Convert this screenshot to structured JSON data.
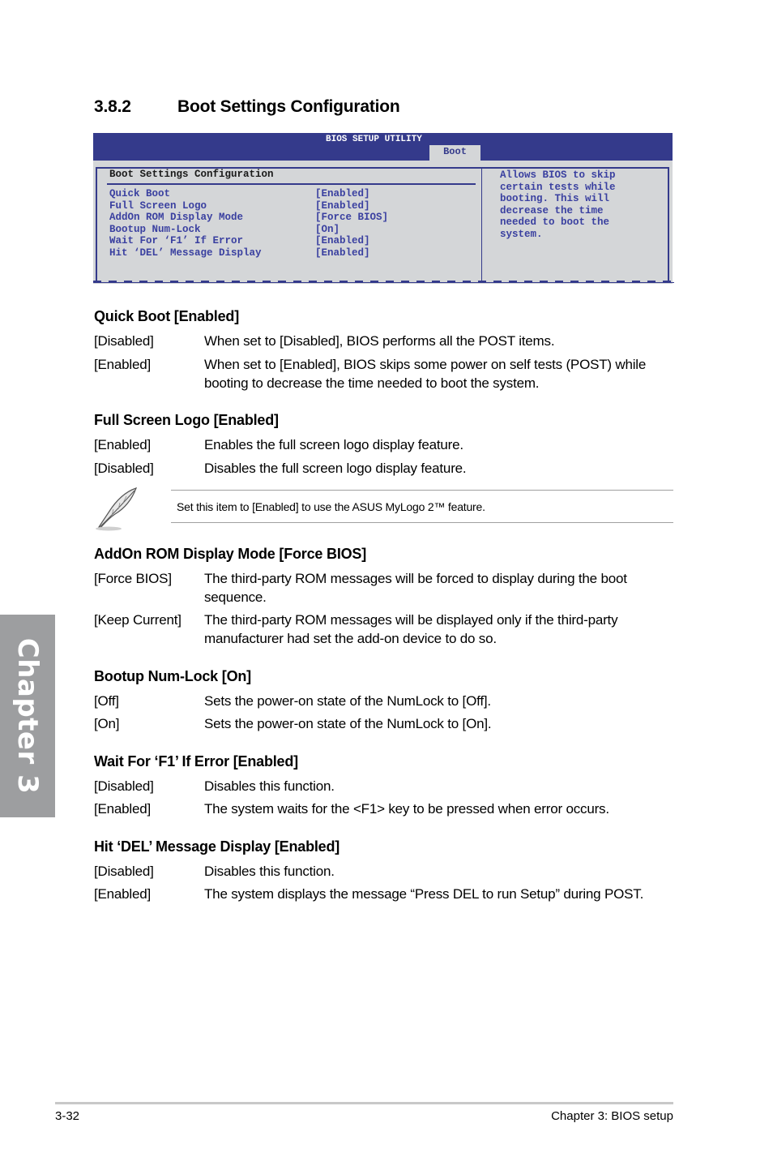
{
  "chapter_tab": "Chapter 3",
  "section": {
    "number": "3.8.2",
    "title": "Boot Settings Configuration"
  },
  "bios": {
    "title": "BIOS SETUP UTILITY",
    "active_tab": "Boot",
    "panel_title": "Boot Settings Configuration",
    "items": [
      {
        "label": "Quick Boot",
        "value": "[Enabled]"
      },
      {
        "label": "Full Screen Logo",
        "value": "[Enabled]"
      },
      {
        "label": "AddOn ROM Display Mode",
        "value": "[Force BIOS]"
      },
      {
        "label": "Bootup Num-Lock",
        "value": "[On]"
      },
      {
        "label": "Wait For ‘F1’ If Error",
        "value": "[Enabled]"
      },
      {
        "label": "Hit ‘DEL’ Message Display",
        "value": "[Enabled]"
      }
    ],
    "help_text": "Allows BIOS to skip\ncertain tests while\nbooting. This will\ndecrease the time\nneeded to boot the\nsystem."
  },
  "sections": [
    {
      "heading": "Quick Boot [Enabled]",
      "options": [
        {
          "key": "[Disabled]",
          "desc": "When set to [Disabled], BIOS performs all the POST items."
        },
        {
          "key": "[Enabled]",
          "desc": "When set to [Enabled], BIOS skips some power on self tests (POST) while booting to decrease the time needed to boot the system."
        }
      ]
    },
    {
      "heading": "Full Screen Logo [Enabled]",
      "options": [
        {
          "key": "[Enabled]",
          "desc": "Enables the full screen logo display feature."
        },
        {
          "key": "[Disabled]",
          "desc": "Disables the full screen logo display feature."
        }
      ]
    },
    {
      "heading": "AddOn ROM Display Mode [Force BIOS]",
      "options": [
        {
          "key": "[Force BIOS]",
          "desc": "The third-party ROM messages will be forced to display during the boot sequence."
        },
        {
          "key": "[Keep Current]",
          "desc": "The third-party ROM messages will be displayed only if the third-party manufacturer had set the add-on device to do so."
        }
      ]
    },
    {
      "heading": "Bootup Num-Lock [On]",
      "options": [
        {
          "key": "[Off]",
          "desc": "Sets the power-on state of the NumLock to [Off]."
        },
        {
          "key": "[On]",
          "desc": "Sets the power-on state of the NumLock to [On]."
        }
      ]
    },
    {
      "heading": "Wait For ‘F1’ If Error [Enabled]",
      "options": [
        {
          "key": "[Disabled]",
          "desc": "Disables this function."
        },
        {
          "key": "[Enabled]",
          "desc": "The system waits for the <F1> key to be pressed when error occurs."
        }
      ]
    },
    {
      "heading": "Hit ‘DEL’ Message Display [Enabled]",
      "options": [
        {
          "key": "[Disabled]",
          "desc": "Disables this function."
        },
        {
          "key": "[Enabled]",
          "desc": "The system displays the message “Press DEL to run Setup” during POST."
        }
      ]
    }
  ],
  "note": {
    "icon": "feather-pen-icon",
    "text": "Set this item to [Enabled] to use the ASUS MyLogo 2™ feature."
  },
  "footer": {
    "page_number": "3-32",
    "chapter_label": "Chapter 3: BIOS setup"
  },
  "colors": {
    "bios_blue": "#343a8b",
    "bios_bg": "#d4d6d8",
    "chapter_tab": "#9d9ea0"
  }
}
